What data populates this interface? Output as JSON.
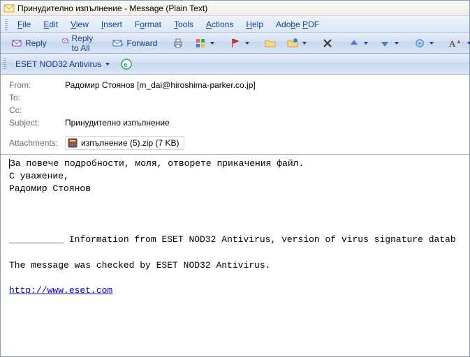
{
  "window": {
    "title": "Принудително изпълнение - Message (Plain Text)"
  },
  "menu": {
    "file": "File",
    "edit": "Edit",
    "view": "View",
    "insert": "Insert",
    "format": "Format",
    "tools": "Tools",
    "actions": "Actions",
    "help": "Help",
    "adobe_pdf": "Adobe PDF"
  },
  "toolbar": {
    "reply": "Reply",
    "reply_all": "Reply to All",
    "forward": "Forward"
  },
  "eset_bar": {
    "label": "ESET NOD32 Antivirus"
  },
  "headers": {
    "from_label": "From:",
    "from_value": "Радомир Стоянов [m_dai@hiroshima-parker.co.jp]",
    "to_label": "To:",
    "to_value": "",
    "cc_label": "Cc:",
    "cc_value": "",
    "subject_label": "Subject:",
    "subject_value": "Принудително изпълнение",
    "attachments_label": "Attachments:",
    "attachment_name": "изпълнение (5).zip (7 KB)"
  },
  "body": {
    "line1": "За повече подробности, моля, отворете прикачения файл.",
    "line2": "С уважение,",
    "line3": "Радомир Стоянов",
    "divider": "__________ ",
    "info": "Information from ESET NOD32 Antivirus, version of virus signature datab",
    "checked": "The message was checked by ESET NOD32 Antivirus.",
    "url": "http://www.eset.com"
  }
}
